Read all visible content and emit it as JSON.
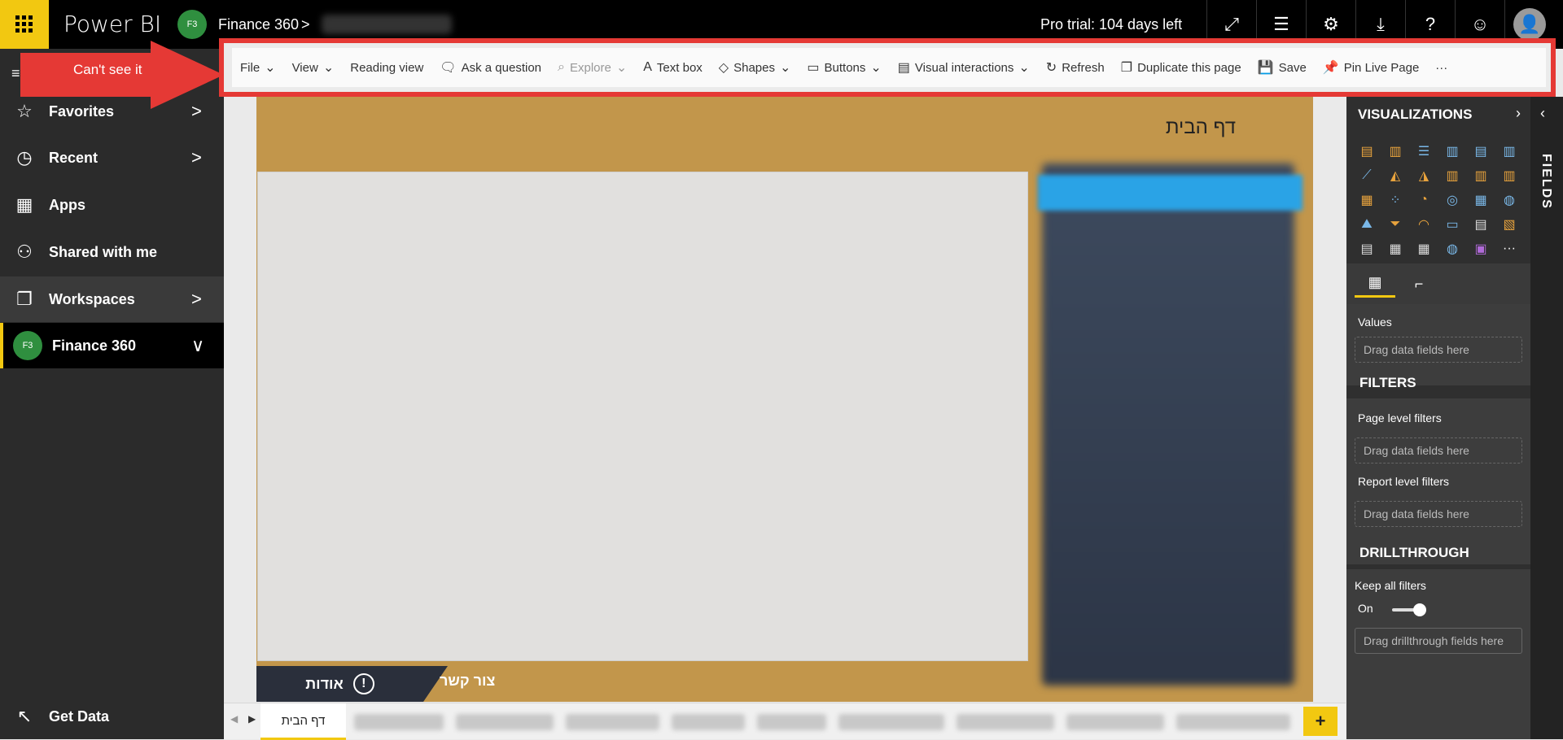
{
  "topbar": {
    "brand": "Power BI",
    "workspace_badge": "F3",
    "workspace_name": "Finance 360",
    "chevron": ">",
    "trial_text": "Pro trial: 104 days left",
    "icons": [
      "fullscreen-icon",
      "comments-icon",
      "gear-icon",
      "download-icon",
      "help-icon",
      "smiley-icon"
    ]
  },
  "sidebar": {
    "items": [
      {
        "label": "Favorites",
        "icon": "☆",
        "chev": ">"
      },
      {
        "label": "Recent",
        "icon": "◷",
        "chev": ">"
      },
      {
        "label": "Apps",
        "icon": "▦",
        "chev": ""
      },
      {
        "label": "Shared with me",
        "icon": "⚇",
        "chev": ""
      },
      {
        "label": "Workspaces",
        "icon": "❐",
        "chev": ">"
      },
      {
        "label": "Finance 360",
        "badge": "F3",
        "chev": "∨"
      }
    ],
    "get_data": "Get Data"
  },
  "toolbar": {
    "file": "File",
    "view": "View",
    "reading_view": "Reading view",
    "ask": "Ask a question",
    "explore": "Explore",
    "text_box": "Text box",
    "shapes": "Shapes",
    "buttons": "Buttons",
    "visual_interactions": "Visual interactions",
    "refresh": "Refresh",
    "duplicate": "Duplicate this page",
    "save": "Save",
    "pin": "Pin Live Page",
    "more": "···"
  },
  "callout": {
    "text": "Can't see it",
    "color": "#e53935"
  },
  "page": {
    "title": "דף הבית",
    "about": "אודות",
    "contact": "צור קשר",
    "accent": "#c2964b"
  },
  "tabs": {
    "active": "דף הבית",
    "add": "+"
  },
  "viz": {
    "title": "VISUALIZATIONS",
    "values_label": "Values",
    "drag_hint": "Drag data fields here",
    "filters_title": "FILTERS",
    "page_filters": "Page level filters",
    "report_filters": "Report level filters",
    "drill_title": "DRILLTHROUGH",
    "keep_filters": "Keep all filters",
    "on": "On",
    "drill_hint": "Drag drillthrough fields here"
  },
  "fields": {
    "label": "FIELDS"
  }
}
